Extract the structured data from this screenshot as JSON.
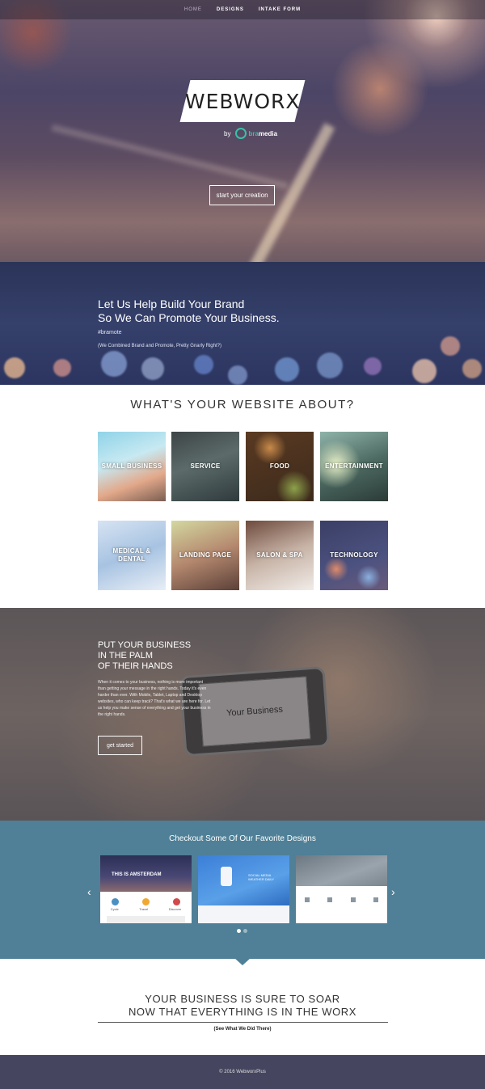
{
  "nav": {
    "items": [
      "HOME",
      "DESIGNS",
      "INTAKE FORM"
    ]
  },
  "hero": {
    "logo": "WEBWORX",
    "by": "by",
    "brand_prefix": "bra",
    "brand_suffix": "media",
    "cta": "start your creation"
  },
  "brand_band": {
    "line1": "Let Us Help Build Your Brand",
    "line2": "So We Can Promote Your Business.",
    "hashtag": "#bramote",
    "note": "(We Combined Brand and Promote, Pretty Gnarly Right?)"
  },
  "about": {
    "title": "WHAT'S YOUR WEBSITE ABOUT?",
    "tiles": [
      "SMALL BUSINESS",
      "SERVICE",
      "FOOD",
      "ENTERTAINMENT",
      "MEDICAL & DENTAL",
      "LANDING PAGE",
      "SALON & SPA",
      "TECHNOLOGY"
    ]
  },
  "palm": {
    "line1": "PUT YOUR BUSINESS",
    "line2": "IN THE PALM",
    "line3": "OF THEIR HANDS",
    "body": "When it comes to your business, nothing is more important than getting your message in the right hands. Today it's even harder than ever. With Mobile, Tablet, Laptop and Desktop websites, who can keep track? That's what we are here for. Let us help you make sense of everything and get your business in the right hands.",
    "phone_text": "Your Business",
    "cta": "get started"
  },
  "designs": {
    "title": "Checkout Some Of Our Favorite Designs",
    "prev": "‹",
    "next": "›",
    "thumb1": {
      "headline": "THIS IS AMSTERDAM",
      "f1": "Cycle",
      "f2": "Travel",
      "f3": "Discover"
    },
    "thumb2": {
      "headline": "SOCIAL MEDIA WEATHER DAILY"
    }
  },
  "soar": {
    "line1": "YOUR BUSINESS IS SURE TO SOAR",
    "line2": "NOW THAT EVERYTHING IS IN THE WORX",
    "sub": "(See What We Did There)"
  },
  "footer": {
    "copyright": "© 2016 WebworxPlus"
  }
}
